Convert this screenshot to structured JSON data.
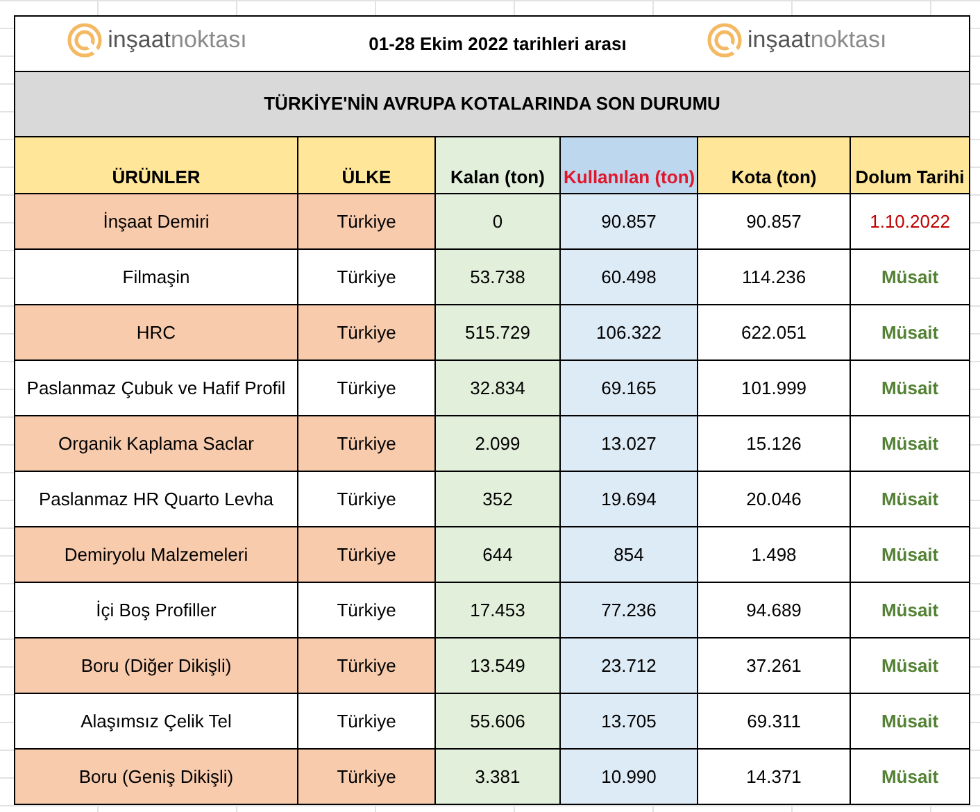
{
  "header": {
    "logos": [
      "**inşaat**noktası",
      "**inşaat**noktası"
    ],
    "period": "01-28 Ekim 2022 tarihleri arası"
  },
  "title": "TÜRKİYE'NİN AVRUPA KOTALARINDA SON DURUMU",
  "columns": [
    "ÜRÜNLER",
    "ÜLKE",
    "Kalan (ton)",
    "Kullanılan (ton)",
    "Kota (ton)",
    "Dolum Tarihi"
  ],
  "rows": [
    {
      "product": "İnşaat Demiri",
      "country": "Türkiye",
      "remaining": "0",
      "used": "90.857",
      "quota": "90.857",
      "status": "1.10.2022",
      "kind": "filled",
      "shaded": true
    },
    {
      "product": "Filmaşin",
      "country": "Türkiye",
      "remaining": "53.738",
      "used": "60.498",
      "quota": "114.236",
      "status": "Müsait",
      "kind": "available",
      "shaded": false
    },
    {
      "product": "HRC",
      "country": "Türkiye",
      "remaining": "515.729",
      "used": "106.322",
      "quota": "622.051",
      "status": "Müsait",
      "kind": "available",
      "shaded": true
    },
    {
      "product": "Paslanmaz Çubuk ve Hafif Profil",
      "country": "Türkiye",
      "remaining": "32.834",
      "used": "69.165",
      "quota": "101.999",
      "status": "Müsait",
      "kind": "available",
      "shaded": false
    },
    {
      "product": "Organik Kaplama Saclar",
      "country": "Türkiye",
      "remaining": "2.099",
      "used": "13.027",
      "quota": "15.126",
      "status": "Müsait",
      "kind": "available",
      "shaded": true
    },
    {
      "product": "Paslanmaz HR Quarto Levha",
      "country": "Türkiye",
      "remaining": "352",
      "used": "19.694",
      "quota": "20.046",
      "status": "Müsait",
      "kind": "available",
      "shaded": false
    },
    {
      "product": "Demiryolu Malzemeleri",
      "country": "Türkiye",
      "remaining": "644",
      "used": "854",
      "quota": "1.498",
      "status": "Müsait",
      "kind": "available",
      "shaded": true
    },
    {
      "product": "İçi Boş Profiller",
      "country": "Türkiye",
      "remaining": "17.453",
      "used": "77.236",
      "quota": "94.689",
      "status": "Müsait",
      "kind": "available",
      "shaded": false
    },
    {
      "product": "Boru (Diğer Dikişli)",
      "country": "Türkiye",
      "remaining": "13.549",
      "used": "23.712",
      "quota": "37.261",
      "status": "Müsait",
      "kind": "available",
      "shaded": true
    },
    {
      "product": "Alaşımsız Çelik Tel",
      "country": "Türkiye",
      "remaining": "55.606",
      "used": "13.705",
      "quota": "69.311",
      "status": "Müsait",
      "kind": "available",
      "shaded": false
    },
    {
      "product": "Boru (Geniş Dikişli)",
      "country": "Türkiye",
      "remaining": "3.381",
      "used": "10.990",
      "quota": "14.371",
      "status": "Müsait",
      "kind": "available",
      "shaded": true
    }
  ]
}
